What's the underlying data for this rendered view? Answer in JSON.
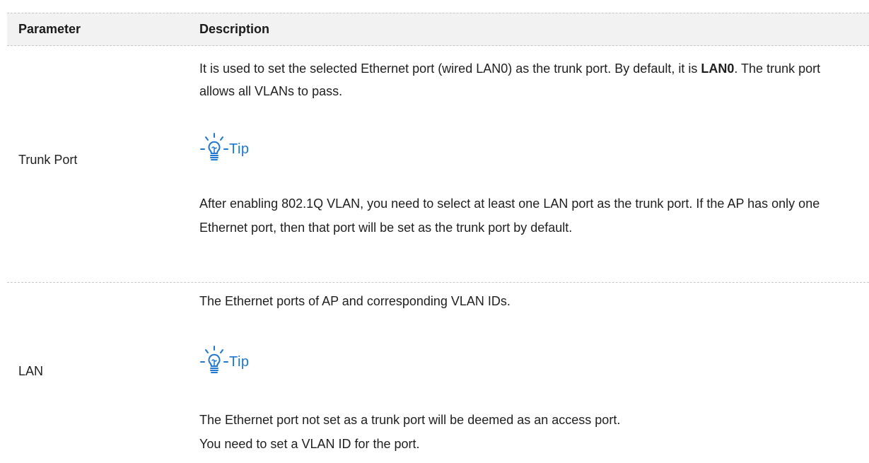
{
  "table": {
    "headers": {
      "parameter": "Parameter",
      "description": "Description"
    },
    "rows": [
      {
        "parameter": "Trunk Port",
        "description_pre": "It is used to set the selected Ethernet port (wired LAN0) as the trunk port. By default, it is ",
        "description_bold": "LAN0",
        "description_post": ". The trunk port allows all VLANs to pass.",
        "tip_label": "Tip",
        "tip_text": "After enabling 802.1Q VLAN, you need to select at least one LAN port as the trunk port. If the AP has only one Ethernet port, then that port will be set as the trunk port by default."
      },
      {
        "parameter": "LAN",
        "description": "The Ethernet ports of AP and corresponding VLAN IDs.",
        "tip_label": "Tip",
        "tip_text_line1": "The Ethernet port not set as a trunk port will be deemed as an access port.",
        "tip_text_line2": "You need to set a VLAN ID for the port."
      }
    ]
  },
  "colors": {
    "tip_blue": "#1e77d3",
    "header_bg": "#f2f2f2",
    "divider": "#c8c8c8"
  },
  "icons": {
    "tip": "lightbulb-icon"
  }
}
